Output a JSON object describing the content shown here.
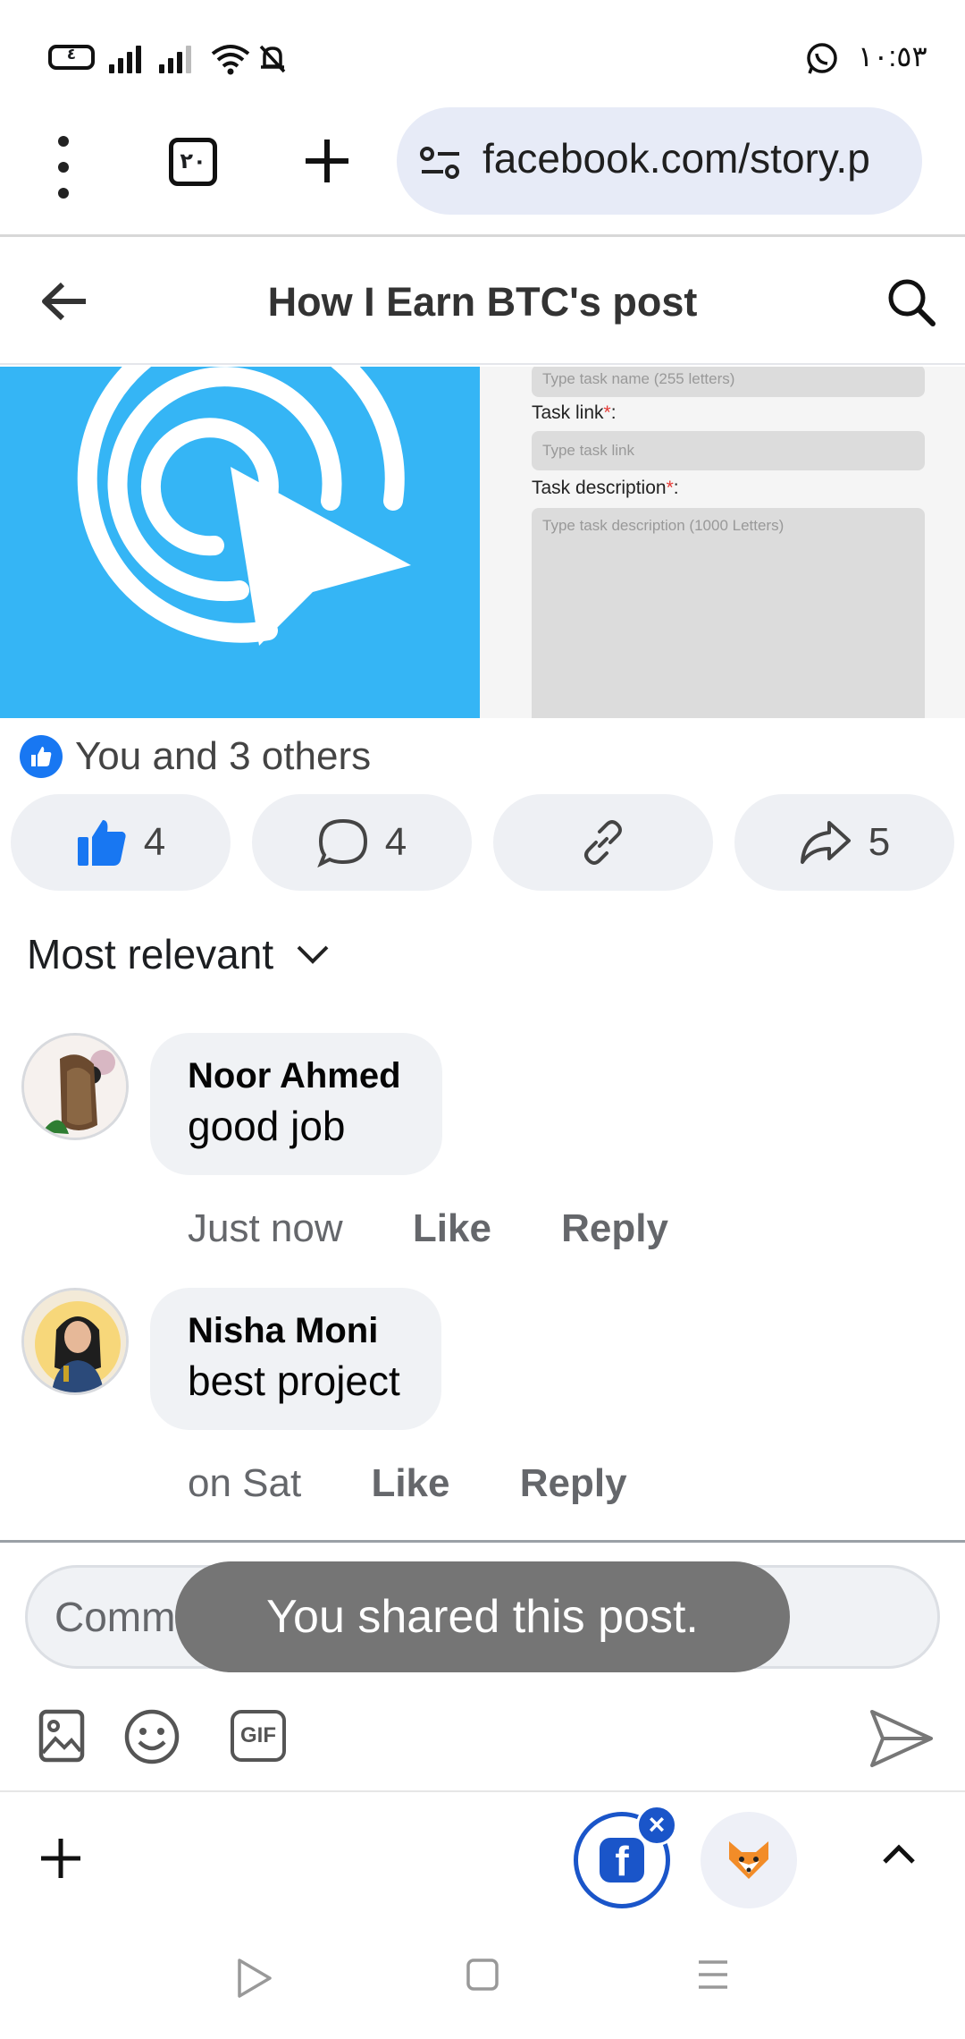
{
  "status_bar": {
    "battery_level": "٤",
    "time": "١٠:٥٣",
    "icons": [
      "battery-icon",
      "signal-icon",
      "signal-icon",
      "wifi-icon",
      "bell-off-icon",
      "whatsapp-icon"
    ]
  },
  "browser": {
    "tab_count": "٢٠",
    "url": "facebook.com/story.p",
    "icons": [
      "more-vert-icon",
      "tabs-icon",
      "plus-icon",
      "site-settings-icon"
    ]
  },
  "header": {
    "title": "How I Earn BTC's post",
    "icons": [
      "back-arrow-icon",
      "search-icon"
    ]
  },
  "post_image": {
    "form": {
      "name_placeholder": "Type task name (255 letters)",
      "link_label": "Task link",
      "link_placeholder": "Type task link",
      "desc_label": "Task description",
      "desc_placeholder": "Type task description (1000 Letters)",
      "required_mark": "*",
      "colon": ":"
    }
  },
  "reactions": {
    "summary": "You and 3 others"
  },
  "actions": {
    "like_count": "4",
    "comment_count": "4",
    "share_count": "5"
  },
  "sort": {
    "label": "Most relevant"
  },
  "comments": [
    {
      "name": "Noor Ahmed",
      "text": "good job",
      "time": "Just now",
      "like": "Like",
      "reply": "Reply"
    },
    {
      "name": "Nisha Moni",
      "text": "best project",
      "time": "on Sat",
      "like": "Like",
      "reply": "Reply"
    }
  ],
  "composer": {
    "placeholder": "Comm",
    "toast": "You shared this post.",
    "gif_label": "GIF"
  },
  "bottom_bar": {
    "fb_letter": "f",
    "close_label": "×"
  },
  "colors": {
    "fb_blue": "#1877f2",
    "pill_bg": "#eef0f4",
    "toast_bg": "#757575",
    "image_blue": "#35b5f5"
  }
}
